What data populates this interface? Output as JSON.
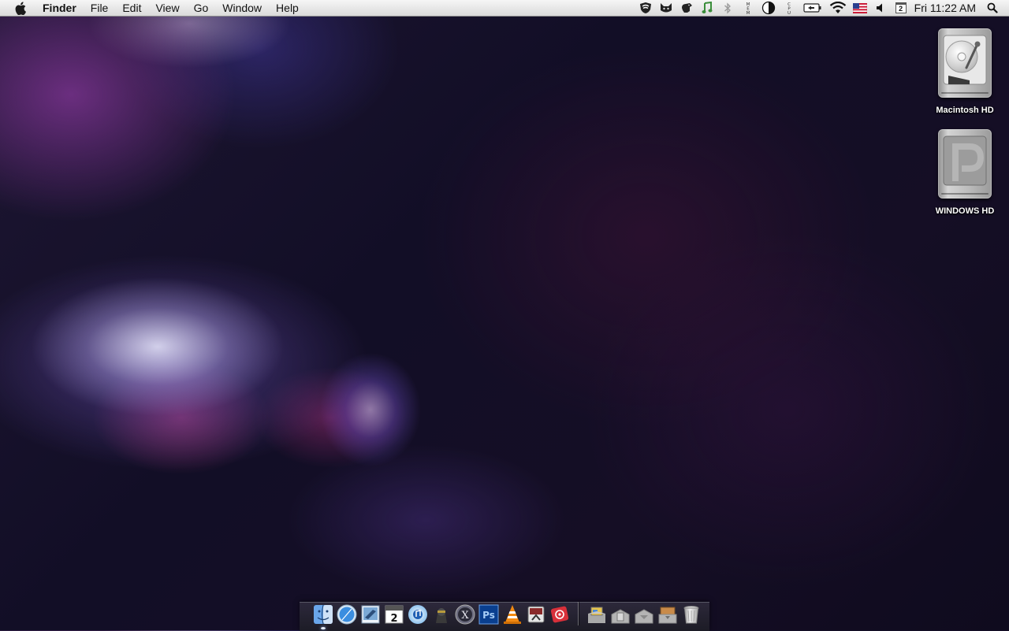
{
  "menubar": {
    "apple_icon": "apple-icon",
    "app_name": "Finder",
    "menus": [
      {
        "label": "File"
      },
      {
        "label": "Edit"
      },
      {
        "label": "View"
      },
      {
        "label": "Go"
      },
      {
        "label": "Window"
      },
      {
        "label": "Help"
      }
    ],
    "extras": [
      {
        "icon": "vpn-shield-icon"
      },
      {
        "icon": "cat-icon"
      },
      {
        "icon": "growl-paw-icon"
      },
      {
        "icon": "music-note-icon"
      },
      {
        "icon": "bluetooth-icon"
      },
      {
        "icon": "memory-meter-icon",
        "text": "MEM"
      },
      {
        "icon": "contrast-icon"
      },
      {
        "icon": "cpu-meter-icon",
        "text": "CPU"
      },
      {
        "icon": "battery-icon"
      },
      {
        "icon": "wifi-icon"
      },
      {
        "icon": "us-flag-input-icon"
      },
      {
        "icon": "volume-icon"
      },
      {
        "icon": "calendar-icon",
        "text": "2"
      }
    ],
    "clock": "Fri 11:22 AM",
    "spotlight_icon": "spotlight-search-icon"
  },
  "desktop": {
    "icons": [
      {
        "label": "Macintosh HD",
        "icon": "hard-drive-icon"
      },
      {
        "label": "WINDOWS HD",
        "icon": "windows-drive-icon"
      }
    ]
  },
  "dock": {
    "apps": [
      {
        "icon": "finder-icon",
        "running": true
      },
      {
        "icon": "safari-icon"
      },
      {
        "icon": "mail-icon"
      },
      {
        "icon": "ical-icon",
        "text": "2"
      },
      {
        "icon": "itunes-icon"
      },
      {
        "icon": "adium-icon"
      },
      {
        "icon": "x11-icon",
        "text": "X"
      },
      {
        "icon": "photoshop-icon",
        "text": "Ps"
      },
      {
        "icon": "vlc-icon"
      },
      {
        "icon": "textmate-icon"
      },
      {
        "icon": "red-app-icon"
      }
    ],
    "stacks": [
      {
        "icon": "applications-stack-icon"
      },
      {
        "icon": "documents-stack-icon"
      },
      {
        "icon": "downloads-stack-icon"
      },
      {
        "icon": "downloads-folder-icon"
      },
      {
        "icon": "trash-icon"
      }
    ],
    "colors": {
      "finder": "#4a90e2",
      "photoshop": "#0a3f8f",
      "vlc": "#f28a12",
      "red_app": "#d9303a"
    }
  }
}
